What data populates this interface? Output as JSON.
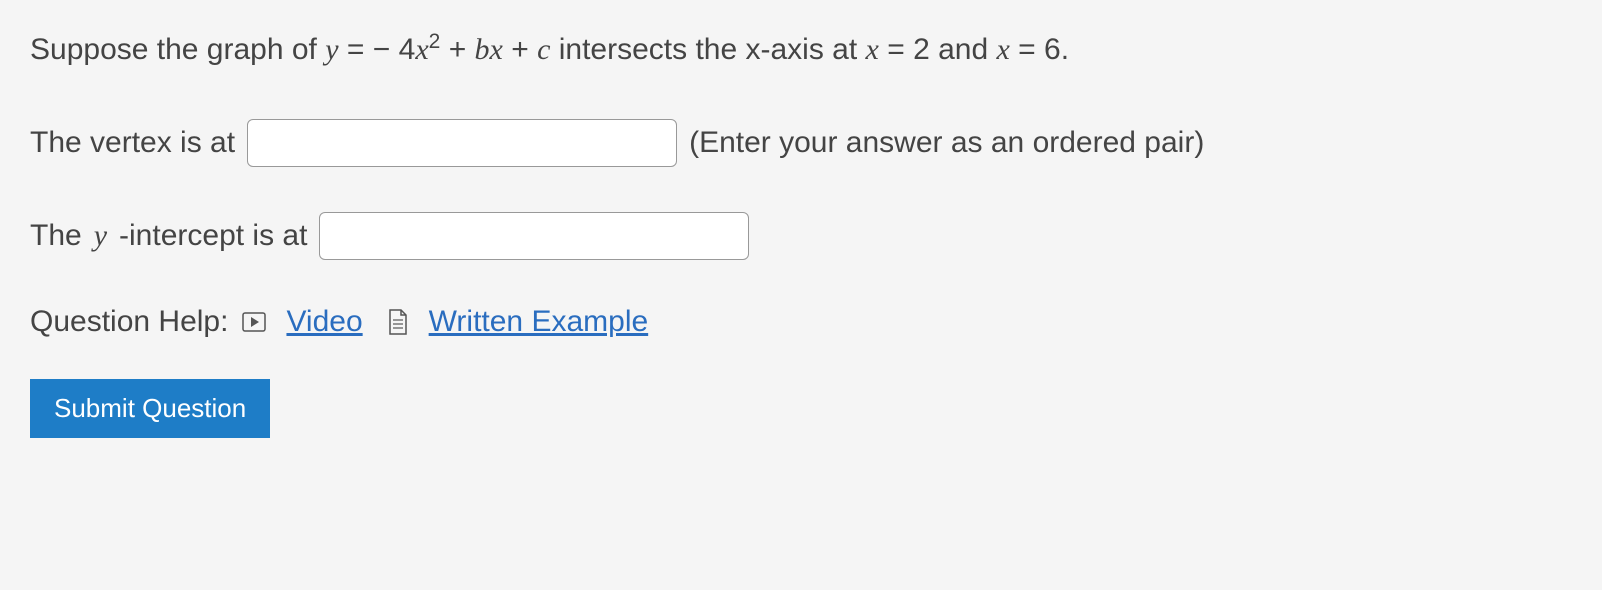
{
  "question": {
    "prefix": "Suppose the graph of ",
    "equation_y": "y",
    "equals1": " = ",
    "minus": "−",
    "coef": "4",
    "x": "x",
    "exp": "2",
    "plus1": " + ",
    "b": "b",
    "x2": "x",
    "plus2": " + ",
    "c": "c",
    "middle": " intersects the x-axis at ",
    "x3": "x",
    "equals2": " = ",
    "val1": "2",
    "and": " and ",
    "x4": "x",
    "equals3": " = ",
    "val2": "6",
    "period": "."
  },
  "vertex": {
    "label": "The vertex is at",
    "value": "",
    "hint": "(Enter your answer as an ordered pair)"
  },
  "yintercept": {
    "label_pre": "The ",
    "label_y": "y",
    "label_post": "-intercept is at",
    "value": ""
  },
  "help": {
    "label": "Question Help:",
    "video": "Video",
    "written": "Written Example"
  },
  "submit": {
    "label": "Submit Question"
  }
}
